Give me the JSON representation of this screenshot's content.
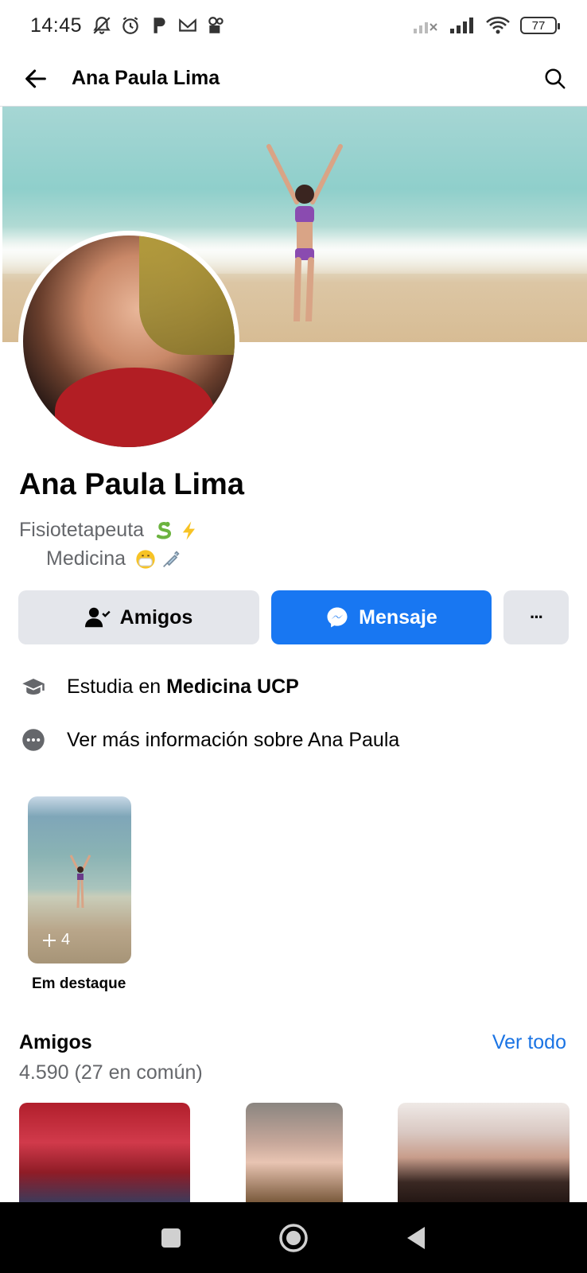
{
  "status_bar": {
    "time": "14:45",
    "battery": "77"
  },
  "app_bar": {
    "title": "Ana Paula Lima",
    "back_icon": "arrow-left-icon",
    "search_icon": "search-icon"
  },
  "profile": {
    "name": "Ana Paula Lima",
    "bio_line1": "Fisiotetapeuta",
    "bio_line2": "Medicina"
  },
  "actions": {
    "friends_label": "Amigos",
    "message_label": "Mensaje",
    "more_label": "···"
  },
  "info": {
    "study_prefix": "Estudia en ",
    "study_place": "Medicina UCP",
    "more_info": "Ver más información sobre Ana Paula"
  },
  "highlights": {
    "count": "4",
    "label": "Em destaque"
  },
  "friends": {
    "title": "Amigos",
    "see_all": "Ver todo",
    "count": "4.590 (27 en común)"
  },
  "colors": {
    "accent": "#1877f2",
    "link": "#1b74e4",
    "secondary_text": "#65676b",
    "button_gray": "#e4e6eb"
  }
}
